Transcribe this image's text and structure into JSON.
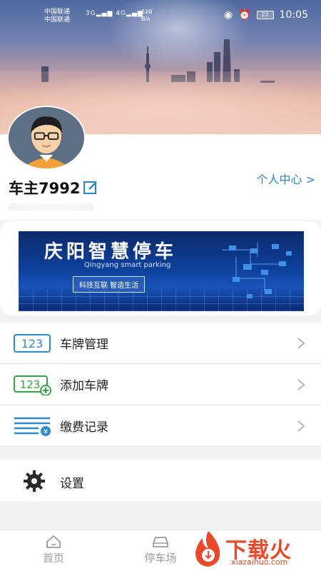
{
  "status_bar": {
    "carrier_1": "中国联通",
    "carrier_2": "中国联通",
    "signal_1": "3G",
    "signal_2": "4G",
    "speed_value": "610",
    "speed_unit": "B/s",
    "battery": "22",
    "time": "10:05"
  },
  "profile": {
    "username": "车主7992",
    "center_link": "个人中心 >"
  },
  "banner": {
    "title": "庆阳智慧停车",
    "subtitle": "Qingyang smart parking",
    "badge": "科技互联 智造生活"
  },
  "menu": {
    "items": [
      {
        "label": "车牌管理",
        "icon": "plate-123-icon"
      },
      {
        "label": "添加车牌",
        "icon": "add-plate-icon"
      },
      {
        "label": "缴费记录",
        "icon": "payment-record-icon"
      }
    ],
    "settings_label": "设置"
  },
  "tabbar": {
    "home": "首页",
    "parking": "停车场"
  },
  "watermark": {
    "text": "下载火",
    "url": "xiazaihuo.com"
  },
  "colors": {
    "accent": "#2b86c7",
    "icon_blue": "#2e8bc9",
    "icon_green": "#3aa34a",
    "watermark": "#e8492a"
  }
}
